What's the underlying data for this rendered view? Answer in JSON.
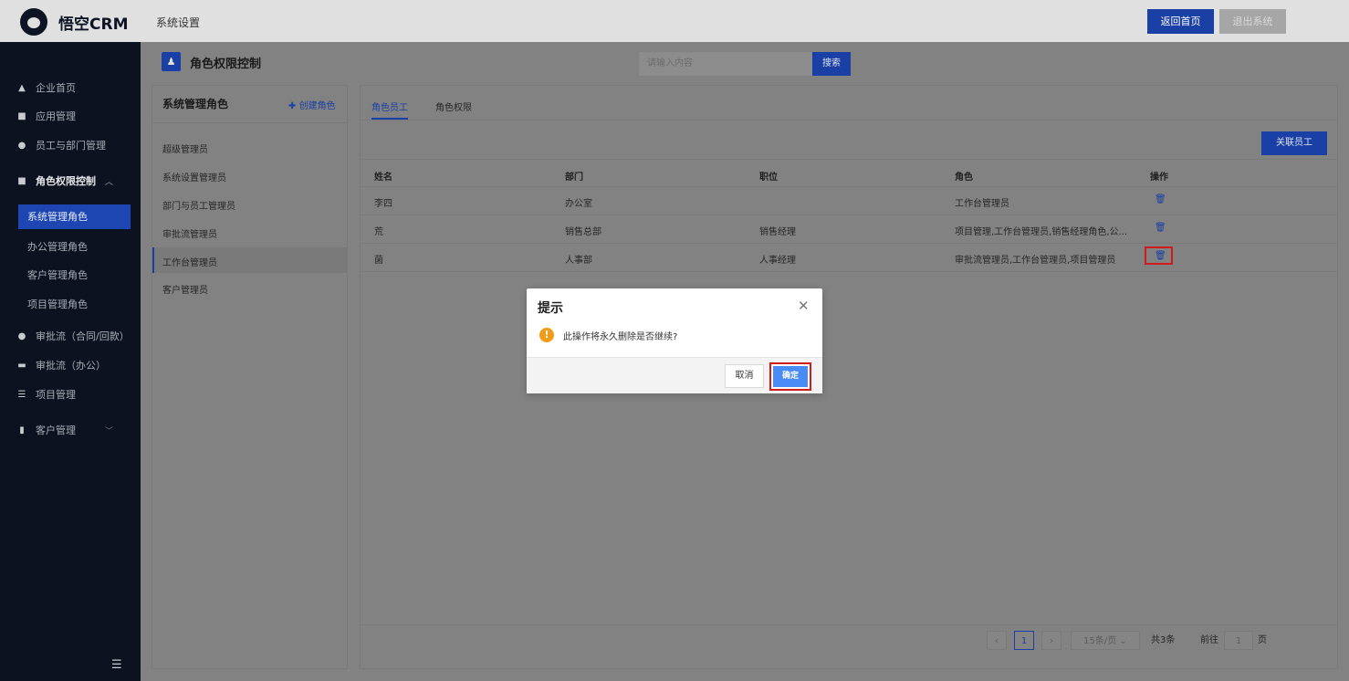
{
  "app": {
    "logo_text": "悟空CRM",
    "section_title": "系统设置"
  },
  "topbar": {
    "home_button": "返回首页",
    "exit_button": "退出系统"
  },
  "sidebar": {
    "items": [
      {
        "label": "企业首页",
        "icon": "home-icon"
      },
      {
        "label": "应用管理",
        "icon": "apps-icon"
      },
      {
        "label": "员工与部门管理",
        "icon": "users-icon"
      },
      {
        "label": "角色权限控制",
        "icon": "permission-icon",
        "expanded": true
      },
      {
        "label": "审批流（合同/回款）",
        "icon": "person-icon"
      },
      {
        "label": "审批流（办公）",
        "icon": "monitor-icon"
      },
      {
        "label": "项目管理",
        "icon": "list-icon"
      },
      {
        "label": "客户管理",
        "icon": "building-icon"
      }
    ],
    "sub_items": [
      "系统管理角色",
      "办公管理角色",
      "客户管理角色",
      "项目管理角色"
    ],
    "active_sub": "系统管理角色"
  },
  "page": {
    "title": "角色权限控制"
  },
  "search": {
    "placeholder": "请输入内容",
    "button": "搜索"
  },
  "role_panel": {
    "title": "系统管理角色",
    "create_label": "创建角色",
    "roles": [
      "超级管理员",
      "系统设置管理员",
      "部门与员工管理员",
      "审批流管理员",
      "工作台管理员",
      "客户管理员"
    ],
    "active_role": "工作台管理员"
  },
  "tabs": [
    "角色员工",
    "角色权限"
  ],
  "active_tab": "角色员工",
  "link_button": "关联员工",
  "table": {
    "headers": [
      "姓名",
      "部门",
      "职位",
      "角色",
      "操作"
    ],
    "rows": [
      {
        "name": "李四",
        "dept": "办公室",
        "position": "",
        "role": "工作台管理员"
      },
      {
        "name": "荒",
        "dept": "销售总部",
        "position": "销售经理",
        "role": "项目管理,工作台管理员,销售经理角色,公..."
      },
      {
        "name": "菌",
        "dept": "人事部",
        "position": "人事经理",
        "role": "审批流管理员,工作台管理员,项目管理员"
      }
    ]
  },
  "pagination": {
    "current_page": "1",
    "page_size": "15条/页",
    "total": "共3条",
    "goto_label": "前往",
    "goto_value": "1",
    "page_unit": "页"
  },
  "dialog": {
    "title": "提示",
    "message": "此操作将永久删除是否继续?",
    "cancel": "取消",
    "confirm": "确定"
  },
  "colors": {
    "brand_blue": "#1a3fa5",
    "confirm_blue": "#4a8cf7",
    "warn_orange": "#f29b18",
    "highlight_red": "#d11a1a"
  }
}
